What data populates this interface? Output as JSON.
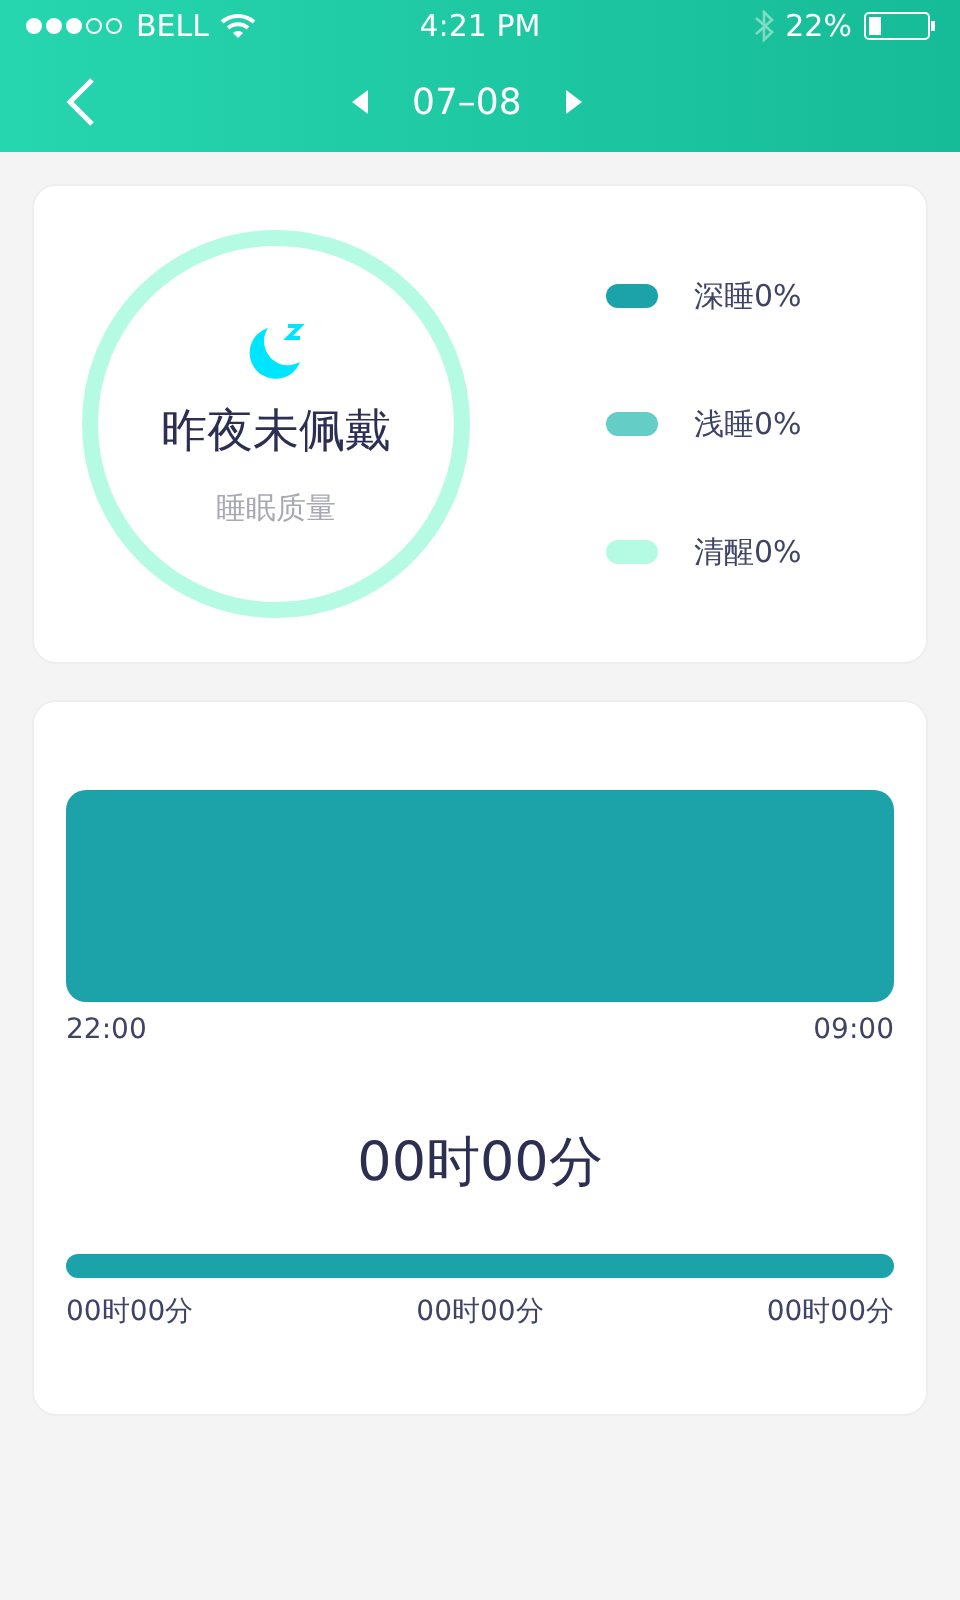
{
  "status_bar": {
    "carrier": "BELL",
    "time": "4:21 PM",
    "battery": "22%"
  },
  "nav": {
    "date": "07–08"
  },
  "summary": {
    "title": "昨夜未佩戴",
    "subtitle": "睡眠质量",
    "legend": [
      {
        "label": "深睡0%",
        "color": "#1ba3a9"
      },
      {
        "label": "浅睡0%",
        "color": "#63cdc6"
      },
      {
        "label": "清醒0%",
        "color": "#b5fbe3"
      }
    ]
  },
  "timeline": {
    "start": "22:00",
    "end": "09:00",
    "total": "00时00分",
    "breakdown": [
      "00时00分",
      "00时00分",
      "00时00分"
    ]
  }
}
